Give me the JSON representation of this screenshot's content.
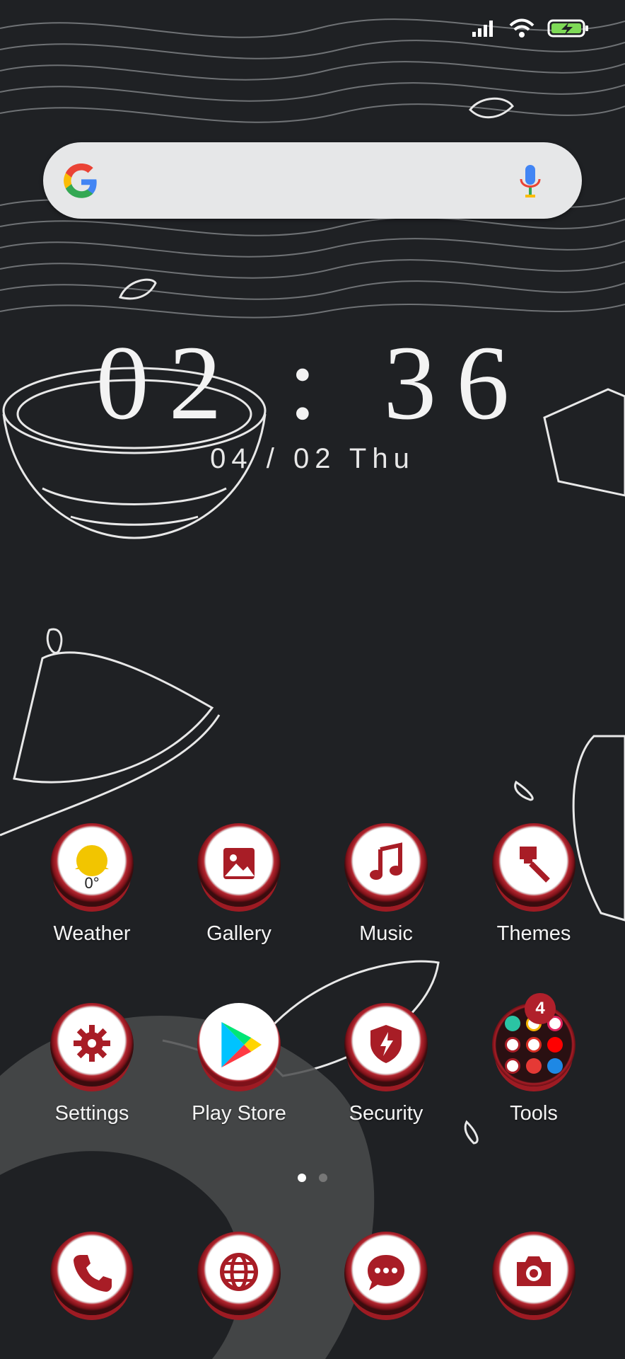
{
  "status_bar": {
    "icons": [
      "signal-icon",
      "wifi-icon",
      "battery-charging-icon"
    ]
  },
  "search": {
    "placeholder": "",
    "logo": "google-logo",
    "voice_icon": "mic-icon"
  },
  "clock": {
    "time": "02 : 36",
    "date": "04 / 02  Thu"
  },
  "apps": [
    {
      "label": "Weather",
      "icon": "weather-sun-icon",
      "temp": "0°"
    },
    {
      "label": "Gallery",
      "icon": "gallery-icon"
    },
    {
      "label": "Music",
      "icon": "music-note-icon"
    },
    {
      "label": "Themes",
      "icon": "paintbrush-icon"
    },
    {
      "label": "Settings",
      "icon": "gear-icon"
    },
    {
      "label": "Play Store",
      "icon": "play-store-icon"
    },
    {
      "label": "Security",
      "icon": "shield-bolt-icon"
    },
    {
      "label": "Tools",
      "icon": "folder-icon",
      "badge": "4"
    }
  ],
  "page_indicator": {
    "count": 2,
    "active": 1
  },
  "dock": [
    {
      "icon": "phone-icon"
    },
    {
      "icon": "globe-icon"
    },
    {
      "icon": "chat-icon"
    },
    {
      "icon": "camera-icon"
    }
  ],
  "colors": {
    "background": "#1f2124",
    "accent": "#b0202b",
    "search_bg": "#e6e7e8"
  }
}
